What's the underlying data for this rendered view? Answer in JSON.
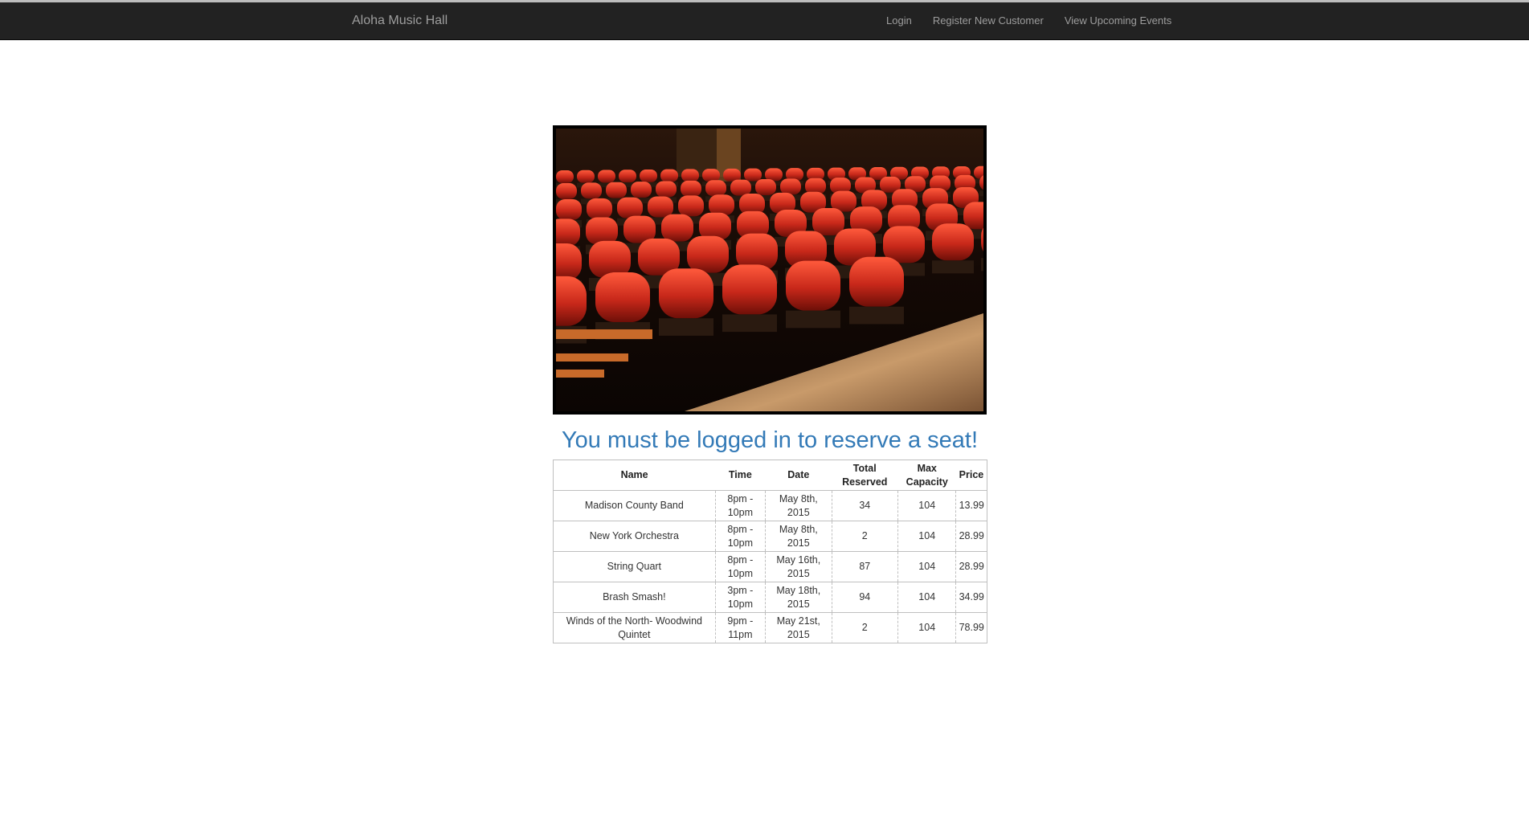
{
  "navbar": {
    "brand": "Aloha Music Hall",
    "links": [
      "Login",
      "Register New Customer",
      "View Upcoming Events"
    ]
  },
  "hero": {
    "image_subject": "rows of red theater seats",
    "colors": {
      "seat": "#c8281a",
      "seat_dark": "#6e0f08",
      "floor": "#b8875a",
      "background": "#1a0d06"
    }
  },
  "notice": "You must be logged in to reserve a seat!",
  "notice_color": "#337ab7",
  "table": {
    "headers": {
      "name": "Name",
      "time": "Time",
      "date": "Date",
      "reserved": "Total Reserved",
      "capacity": "Max Capacity",
      "price": "Price"
    },
    "rows": [
      {
        "name": "Madison County Band",
        "time": "8pm - 10pm",
        "date": "May 8th, 2015",
        "reserved": "34",
        "capacity": "104",
        "price": "13.99"
      },
      {
        "name": "New York Orchestra",
        "time": "8pm - 10pm",
        "date": "May 8th, 2015",
        "reserved": "2",
        "capacity": "104",
        "price": "28.99"
      },
      {
        "name": "String Quart",
        "time": "8pm - 10pm",
        "date": "May 16th, 2015",
        "reserved": "87",
        "capacity": "104",
        "price": "28.99"
      },
      {
        "name": "Brash Smash!",
        "time": "3pm - 10pm",
        "date": "May 18th, 2015",
        "reserved": "94",
        "capacity": "104",
        "price": "34.99"
      },
      {
        "name": "Winds of the North- Woodwind Quintet",
        "time": "9pm - 11pm",
        "date": "May 21st, 2015",
        "reserved": "2",
        "capacity": "104",
        "price": "78.99"
      }
    ]
  }
}
